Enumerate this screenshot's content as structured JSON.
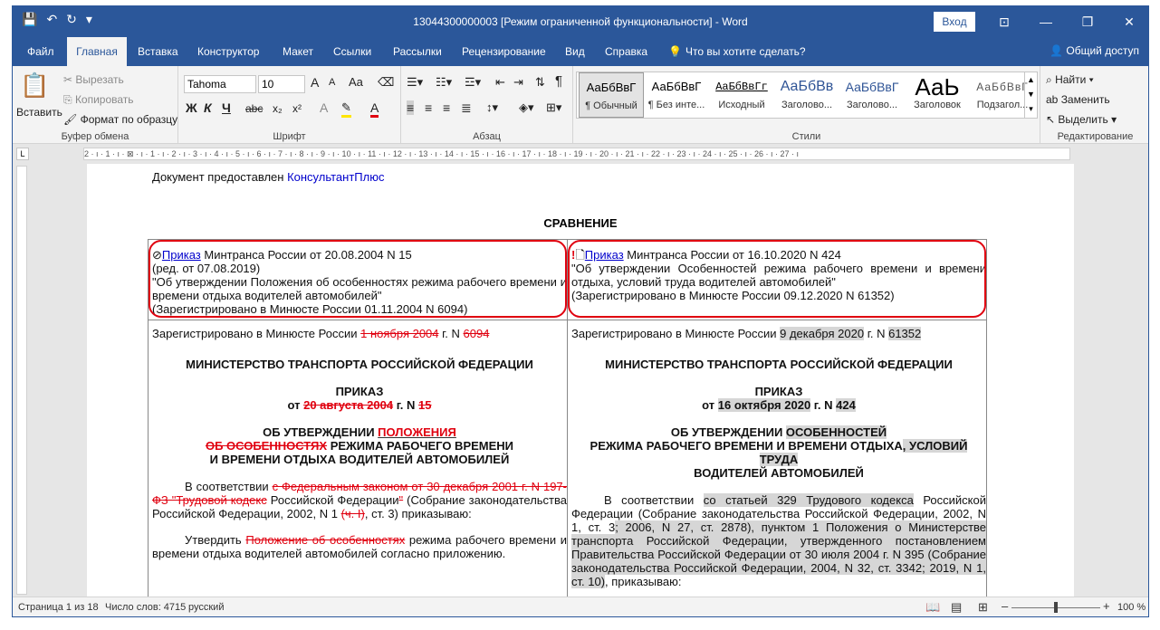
{
  "window": {
    "title": "13044300000003 [Режим ограниченной функциональности]  -  Word",
    "login_label": "Вход",
    "controls": {
      "ribbon_options": "⊡",
      "minimize": "—",
      "restore": "❐",
      "close": "✕"
    }
  },
  "qat": {
    "save": "💾",
    "undo": "↶",
    "redo": "↻",
    "customize": "▾"
  },
  "tabs": {
    "file": "Файл",
    "home": "Главная",
    "insert": "Вставка",
    "design": "Конструктор",
    "layout": "Макет",
    "references": "Ссылки",
    "mailings": "Рассылки",
    "review": "Рецензирование",
    "view": "Вид",
    "help": "Справка",
    "tellme": "Что вы хотите сделать?",
    "share": "Общий доступ"
  },
  "ribbon": {
    "clipboard": {
      "paste": "Вставить",
      "cut": "Вырезать",
      "copy": "Копировать",
      "format_painter": "Формат по образцу",
      "label": "Буфер обмена"
    },
    "font": {
      "name": "Tahoma",
      "size": "10",
      "grow": "A",
      "shrink": "A",
      "case": "Aa",
      "bold": "Ж",
      "italic": "К",
      "underline": "Ч",
      "strike": "abc",
      "subscript": "x₂",
      "superscript": "x²",
      "label": "Шрифт"
    },
    "paragraph": {
      "label": "Абзац",
      "pilcrow": "¶"
    },
    "styles": {
      "label": "Стили",
      "items": [
        {
          "preview": "АаБбВвГ",
          "name": "¶ Обычный"
        },
        {
          "preview": "АаБбВвГ",
          "name": "¶ Без инте..."
        },
        {
          "preview": "АаБбВвГг",
          "name": "Исходный"
        },
        {
          "preview": "АаБбВв",
          "name": "Заголово..."
        },
        {
          "preview": "АаБбВвГ",
          "name": "Заголово..."
        },
        {
          "preview": "АаЬ",
          "name": "Заголовок"
        },
        {
          "preview": "АаБбВвГ",
          "name": "Подзагол..."
        }
      ]
    },
    "editing": {
      "find": "Найти",
      "replace": "Заменить",
      "select": "Выделить",
      "label": "Редактирование"
    }
  },
  "ruler": {
    "text": "2 · ı · 1 · ı · ⊠ · ı · 1 · ı · 2 · ı · 3 · ı · 4 · ı · 5 · ı · 6 · ı · 7 · ı · 8 · ı · 9 · ı · 10 · ı · 11 · ı · 12 · ı · 13 · ı · 14 · ı · 15 · ı · 16 · ı · 17 · ı · 18 · ı · 19 · ı · 20 · ı · 21 · ı · 22 · ı · 23 · ı · 24 · ı · 25 · ı · 26 · ı · 27 · ı"
  },
  "document": {
    "provided_prefix": "Документ предоставлен ",
    "provided_link": "КонсультантПлюс",
    "title": "СРАВНЕНИЕ",
    "left": {
      "hdr_link": "Приказ",
      "hdr_line1": " Минтранса России от 20.08.2004 N 15",
      "hdr_line2": "(ред. от 07.08.2019)",
      "hdr_line3": "\"Об утверждении Положения об особенностях режима рабочего времени и времени отдыха водителей автомобилей\"",
      "hdr_line4": "(Зарегистрировано в Минюсте России 01.11.2004 N 6094)",
      "reg_prefix": "Зарегистрировано в Минюсте России ",
      "reg_date": "1 ноября 2004",
      "reg_mid": " г. N ",
      "reg_num": "6094",
      "ministry": "МИНИСТЕРСТВО ТРАНСПОРТА РОССИЙСКОЙ ФЕДЕРАЦИИ",
      "order": "ПРИКАЗ",
      "order_from": "от ",
      "order_date": "20 августа 2004",
      "order_mid": " г. N ",
      "order_num": "15",
      "subj_a": "ОБ УТВЕРЖДЕНИИ ",
      "subj_b": "ПОЛОЖЕНИЯ",
      "subj_c": "ОБ ОСОБЕННОСТЯХ",
      "subj_d": " РЕЖИМА РАБОЧЕГО ВРЕМЕНИ",
      "subj_e": "И ВРЕМЕНИ ОТДЫХА ВОДИТЕЛЕЙ АВТОМОБИЛЕЙ",
      "p1_a": "В соответствии ",
      "p1_b": "с Федеральным законом от 30 декабря 2001 г. N 197-ФЗ \"Трудовой кодекс",
      "p1_c": " Российской Федерации",
      "p1_d": "\"",
      "p1_e": " (Собрание законодательства Российской Федерации, 2002, N 1 ",
      "p1_f": "(ч. I)",
      "p1_g": ", ст. 3) приказываю:",
      "p2_a": "Утвердить ",
      "p2_b": "Положение об особенностях",
      "p2_c": " режима рабочего времени и времени отдыха водителей автомобилей согласно приложению."
    },
    "right": {
      "hdr_link": "Приказ",
      "hdr_line1": " Минтранса России от 16.10.2020 N 424",
      "hdr_line2": "\"Об утверждении Особенностей режима рабочего времени и времени отдыха, условий труда водителей автомобилей\"",
      "hdr_line3": "(Зарегистрировано в Минюсте России 09.12.2020 N 61352)",
      "reg_prefix": "Зарегистрировано в Минюсте России ",
      "reg_date": "9 декабря 2020",
      "reg_mid": " г. N ",
      "reg_num": "61352",
      "ministry": "МИНИСТЕРСТВО ТРАНСПОРТА РОССИЙСКОЙ ФЕДЕРАЦИИ",
      "order": "ПРИКАЗ",
      "order_from": "от ",
      "order_date": "16 октября 2020",
      "order_mid": " г. N ",
      "order_num": "424",
      "subj_a": "ОБ УТВЕРЖДЕНИИ ",
      "subj_b": "ОСОБЕННОСТЕЙ",
      "subj_c": "РЕЖИМА РАБОЧЕГО ВРЕМЕНИ И ВРЕМЕНИ ОТДЫХА",
      "subj_d": ", УСЛОВИЙ ТРУДА",
      "subj_e": "ВОДИТЕЛЕЙ АВТОМОБИЛЕЙ",
      "p1_a": "В соответствии ",
      "p1_b": "со статьей 329 Трудового кодекса",
      "p1_c": " Российской Федерации (Собрание законодательства Российской Федерации, 2002, N 1, ст. 3",
      "p1_d": "; 2006, N 27, ст. 2878), пунктом 1 Положения о Министерстве транспорта Российской Федерации, утвержденного постановлением Правительства Российской Федерации от 30 июля 2004 г. N 395 (Собрание законодательства Российской Федерации, 2004, N 32, ст. 3342; 2019, N 1, ст. 10)",
      "p1_e": ", приказываю:"
    }
  },
  "status": {
    "page": "Страница 1 из 18",
    "words": "Число слов: 4715",
    "lang": "русский",
    "zoom": "100 %",
    "zoom_minus": "–",
    "zoom_plus": "+"
  }
}
